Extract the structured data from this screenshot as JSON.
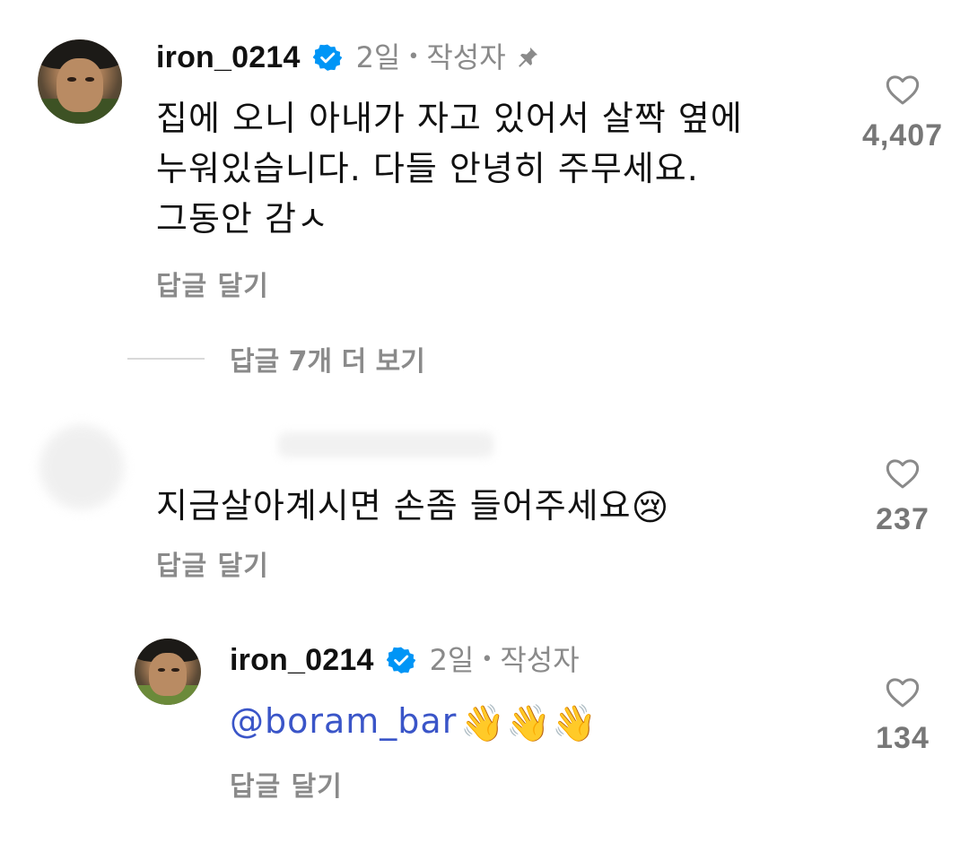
{
  "comments": [
    {
      "username": "iron_0214",
      "time": "2일",
      "dot": "•",
      "author_badge": "작성자",
      "pinned": true,
      "text_lines": [
        "집에 오니 아내가 자고 있어서 살짝 옆에",
        "누워있습니다. 다들 안녕히 주무세요.",
        "그동안 감ㅅ"
      ],
      "reply_label": "답글 달기",
      "likes": "4,407",
      "icons": [
        "verified-icon",
        "pin-icon",
        "heart-icon"
      ]
    },
    {
      "text": "지금살아계시면 손좀 들어주세요",
      "emoji": "😢",
      "reply_label": "답글 달기",
      "likes": "237",
      "icons": [
        "heart-icon"
      ]
    },
    {
      "username": "iron_0214",
      "time": "2일",
      "dot": "•",
      "author_badge": "작성자",
      "mention": "@boram_bar",
      "emoji": "👋👋👋",
      "reply_label": "답글 달기",
      "likes": "134",
      "icons": [
        "verified-icon",
        "heart-icon"
      ]
    }
  ],
  "more_replies_label": "답글 7개 더 보기",
  "colors": {
    "verified": "#0095f6",
    "secondary_text": "#8a8a8a",
    "mention": "#3a55c8"
  }
}
